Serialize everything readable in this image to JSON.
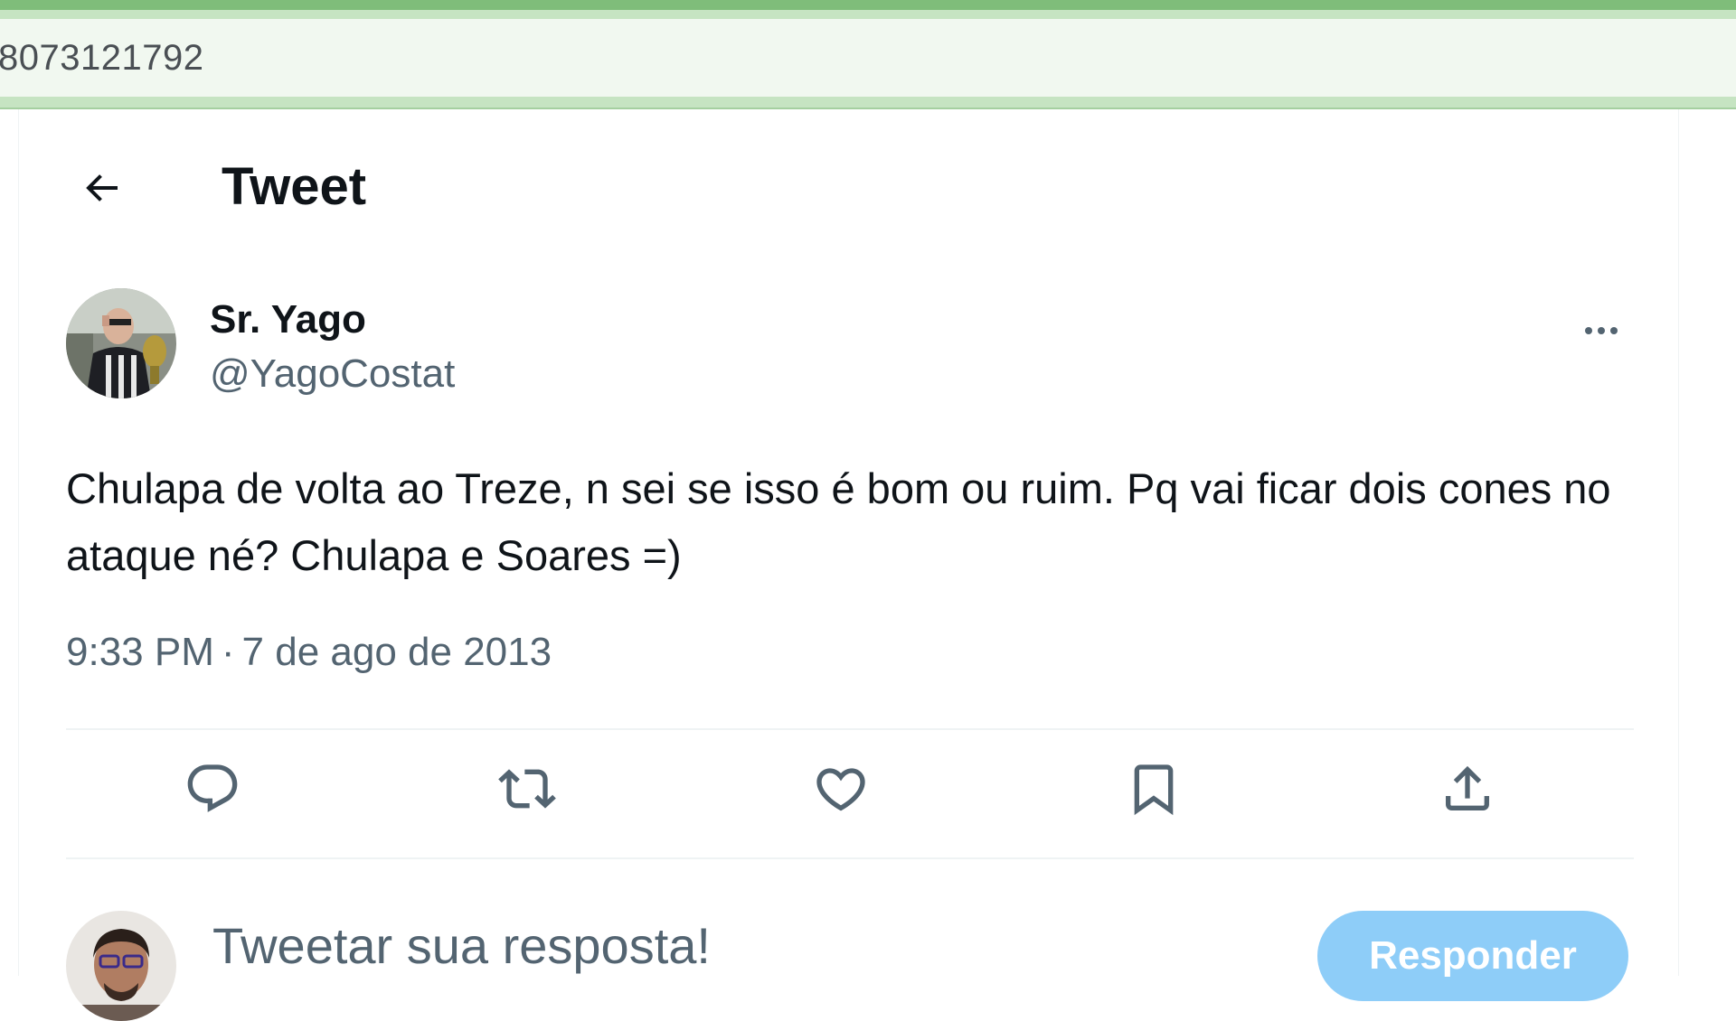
{
  "browser": {
    "url_fragment": "8073121792"
  },
  "header": {
    "title": "Tweet",
    "back_icon": "arrow-left-icon"
  },
  "tweet": {
    "author_name": "Sr. Yago",
    "author_handle": "@YagoCostat",
    "text": "Chulapa de volta ao Treze, n sei se isso é bom ou ruim. Pq vai ficar dois cones no ataque né? Chulapa e Soares =)",
    "time": "9:33 PM",
    "separator": "·",
    "date": "7 de ago de 2013",
    "more_icon": "more-horizontal-icon"
  },
  "actions": [
    {
      "icon": "reply-icon"
    },
    {
      "icon": "retweet-icon"
    },
    {
      "icon": "like-icon"
    },
    {
      "icon": "bookmark-icon"
    },
    {
      "icon": "share-icon"
    }
  ],
  "reply_box": {
    "placeholder": "Tweetar sua resposta!",
    "button_label": "Responder"
  },
  "colors": {
    "text_primary": "#0f1419",
    "text_secondary": "#536471",
    "reply_button_disabled": "#8ecdf8",
    "browser_accent": "#7fbd7a"
  }
}
